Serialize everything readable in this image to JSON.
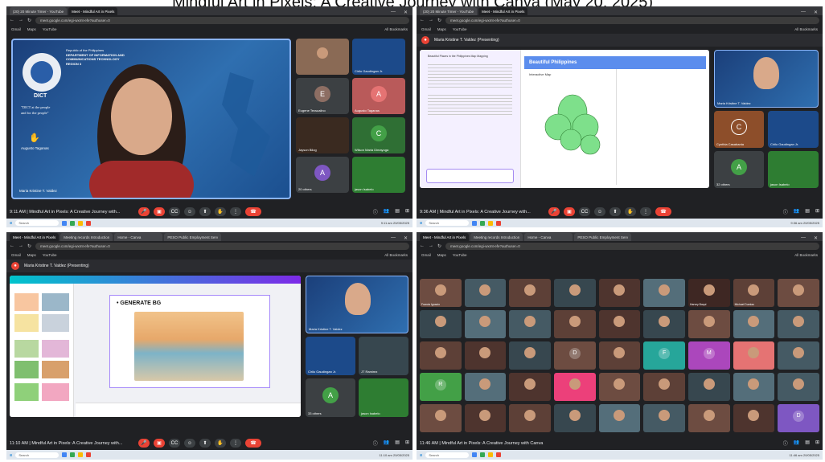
{
  "headline": "Mindful Art in Pixels: A Creative Journey with Canva (May 20, 2025)",
  "p1": {
    "tabs": [
      "(20) 20 Minute Timer - YouTube",
      "Meet - Mindful Art in Pixels"
    ],
    "url": "meet.google.com/egi-wxmt-efe?authuser=0",
    "bookmarks": [
      "Gmail",
      "Maps",
      "YouTube"
    ],
    "bookmarks_right": "All Bookmarks",
    "org_line1": "Republic of the Philippines",
    "org_line2": "DEPARTMENT OF INFORMATION AND",
    "org_line3": "COMMUNICATIONS TECHNOLOGY",
    "org_line4": "REGION 3",
    "logo": "DICT",
    "motto1": "\"DICT at the people",
    "motto2": "and for the people\"",
    "main_name": "Maria Kristine T. Valdez",
    "raised_name": "Augusto Taganas",
    "tiles": [
      {
        "name": "",
        "letter": "",
        "color": "#8a6a55"
      },
      {
        "name": "Cirilo Gaudingan Jr.",
        "letter": "",
        "color": "#1c4a8a"
      },
      {
        "name": "Eugene Tecsualino",
        "letter": "E",
        "color": "#8d6e63"
      },
      {
        "name": "Augusto Taganas",
        "letter": "A",
        "color": "#e57373"
      },
      {
        "name": "Jayson Bilog",
        "letter": "",
        "color": "#3a2a20"
      },
      {
        "name": "Wilson Maria Dimayuga",
        "letter": "C",
        "color": "#43a047"
      },
      {
        "name": "20 others",
        "letter": "A",
        "color": "#7e57c2"
      },
      {
        "name": "jason Isabelo",
        "letter": "",
        "color": "#2e7d32"
      }
    ],
    "time": "9:11 AM | Mindful Art in Pixels: A Creative Journey with...",
    "taskbar_search": "Search",
    "tray": "9:11 am 20/05/2025"
  },
  "p2": {
    "tabs": [
      "(20) 20 Minute Timer - YouTube",
      "Meet - Mindful Art in Pixels"
    ],
    "url": "meet.google.com/egi-wxmt-efe?authuser=0",
    "bookmarks": [
      "Gmail",
      "Maps",
      "YouTube"
    ],
    "bookmarks_right": "All Bookmarks",
    "presenting": "Maria Kristine T. Valdez (Presenting)",
    "canva_title": "Beautiful Philippines",
    "canva_sub": "Interactive Map",
    "canva_left_title": "Beautiful Places in the Philippines Map Mapping",
    "presenter_name": "Maria Kristine T. Valdez",
    "tiles": [
      {
        "name": "Cynthia Casabanta",
        "letter": "C",
        "color": "#8d4e2a"
      },
      {
        "name": "Cirilo Gaudingan Jr.",
        "letter": "",
        "color": "#1c4a8a"
      },
      {
        "name": "32 others",
        "letter": "A",
        "color": "#43a047"
      },
      {
        "name": "jason Isabelo",
        "letter": "",
        "color": "#2e7d32"
      }
    ],
    "time": "9:36 AM | Mindful Art in Pixels: A Creative Journey with...",
    "taskbar_search": "Search",
    "tray": "9:36 am 20/05/2025"
  },
  "p3": {
    "tabs": [
      "Meet - Mindful Art in Pixels",
      "Meeting records Introduction",
      "Home - Canva",
      "PESO Public Employment Serv"
    ],
    "url": "meet.google.com/egi-wxmt-efe?authuser=0",
    "bookmarks": [
      "Gmail",
      "Maps",
      "YouTube"
    ],
    "bookmarks_right": "All Bookmarks",
    "presenting": "Maria Kristine T. Valdez (Presenting)",
    "slide_title": "• GENERATE BG",
    "presenter_name": "Maria Kristine T. Valdez",
    "tiles": [
      {
        "name": "Cirilo Gaudingan Jr.",
        "letter": "",
        "color": "#1c4a8a"
      },
      {
        "name": "JT Ramirez",
        "letter": "",
        "color": "#37474f"
      },
      {
        "name": "33 others",
        "letter": "A",
        "color": "#43a047"
      },
      {
        "name": "jason Isabelo",
        "letter": "",
        "color": "#2e7d32"
      }
    ],
    "time": "11:10 AM | Mindful Art in Pixels: A Creative Journey with...",
    "taskbar_search": "Search",
    "tray": "11:10 am 20/05/2025"
  },
  "p4": {
    "tabs": [
      "Meet - Mindful Art in Pixels",
      "Meeting records Introduction",
      "Home - Canva",
      "PESO Public Employment Serv"
    ],
    "url": "meet.google.com/egi-wxmt-efe?authuser=0",
    "bookmarks": [
      "Gmail",
      "Maps",
      "YouTube"
    ],
    "bookmarks_right": "All Bookmarks",
    "grid_names": [
      "Francis Ignacio",
      "",
      "",
      "",
      "",
      "",
      "Harvey Baqui",
      "Michael Dumlao",
      "",
      "",
      "",
      "",
      "",
      "",
      "",
      "",
      "",
      "",
      "",
      "",
      "",
      "",
      "",
      "",
      "",
      "",
      "",
      "",
      "",
      "",
      "",
      "",
      "",
      "",
      "",
      "",
      "",
      "",
      "",
      "",
      "",
      "",
      "",
      "",
      "",
      "",
      ""
    ],
    "grid_letters": [
      "",
      "",
      "",
      "",
      "",
      "",
      "",
      "",
      "",
      "",
      "",
      "",
      "",
      "",
      "",
      "",
      "",
      "",
      "",
      "",
      "",
      "D",
      "",
      "F",
      "M",
      "",
      "",
      "R",
      "",
      "",
      "",
      "",
      "",
      "",
      "",
      "",
      "",
      "",
      "",
      "",
      "",
      "",
      "",
      "",
      "D",
      "",
      ""
    ],
    "grid_colors": [
      "#6d4c41",
      "#455a64",
      "#5d4037",
      "#37474f",
      "#4e342e",
      "#546e7a",
      "#3e2723",
      "#5d4037",
      "#6d4c41",
      "#37474f",
      "#546e7a",
      "#455a64",
      "#5d4037",
      "#4e342e",
      "#37474f",
      "#6d4c41",
      "#546e7a",
      "#455a64",
      "#5d4037",
      "#4e342e",
      "#37474f",
      "#6d4c41",
      "#5d4037",
      "#26a69a",
      "#ab47bc",
      "#e57373",
      "#455a64",
      "#43a047",
      "#546e7a",
      "#4e342e",
      "#ec407a",
      "#6d4c41",
      "#5d4037",
      "#37474f",
      "#546e7a",
      "#455a64",
      "#6d4c41",
      "#4e342e",
      "#5d4037",
      "#37474f",
      "#546e7a",
      "#455a64",
      "#6d4c41",
      "#4e342e",
      "#7e57c2",
      "#37474f",
      "#2e7d32"
    ],
    "time": "11:46 AM | Mindful Art in Pixels: A Creative Journey with Canva",
    "taskbar_search": "Search",
    "tray": "11:46 am 20/05/2025"
  }
}
